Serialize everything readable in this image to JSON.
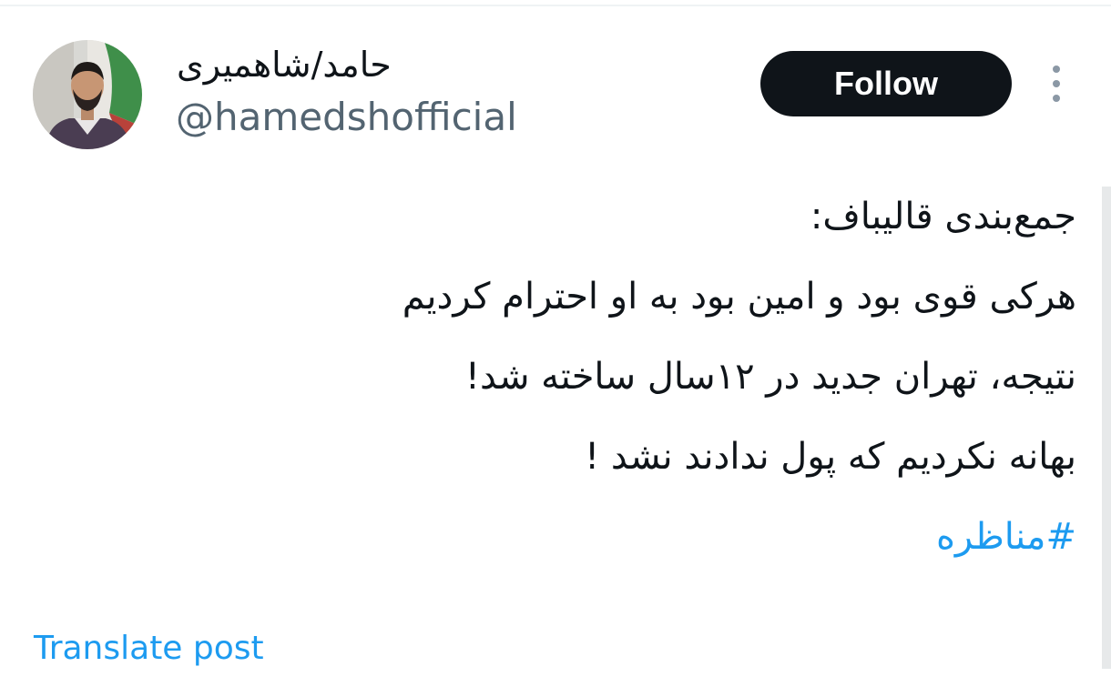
{
  "tweet": {
    "author": {
      "display_name": "حامد/شاهمیری",
      "handle": "@hamedshofficial",
      "avatar_icon": "profile-photo"
    },
    "follow_label": "Follow",
    "more_icon": "vertical-ellipsis-icon",
    "lines": [
      "جمع‌بندی قالیباف:",
      "هرکی قوی بود و امین بود به او احترام کردیم",
      "نتیجه، تهران جدید در ۱۲سال ساخته شد!",
      "بهانه نکردیم که پول ندادند نشد !"
    ],
    "hashtag": "#مناظره",
    "translate_label": "Translate post"
  },
  "colors": {
    "text_primary": "#0f1419",
    "text_secondary": "#536471",
    "link": "#1d9bf0",
    "button_bg": "#0f1419",
    "button_text": "#ffffff"
  }
}
